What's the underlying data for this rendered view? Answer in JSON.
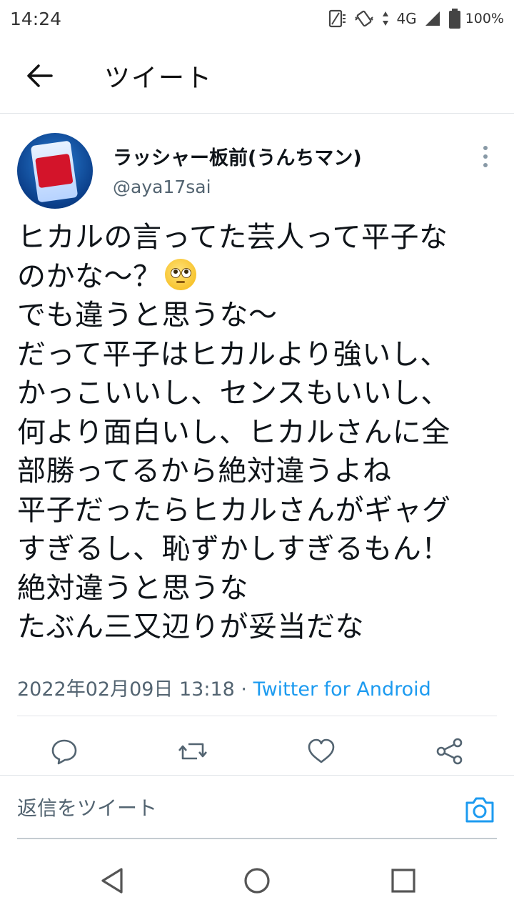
{
  "status_bar": {
    "time": "14:24",
    "network": "4G",
    "battery": "100%"
  },
  "header": {
    "title": "ツイート",
    "back_icon": "arrow-left-icon"
  },
  "tweet": {
    "display_name": "ラッシャー板前(うんちマン)",
    "handle": "@aya17sai",
    "text_lines": [
      "ヒカルの言ってた芸人って平子な",
      "のかな〜？",
      "でも違うと思うな〜",
      "だって平子はヒカルより強いし、",
      "かっこいいし、センスもいいし、",
      "何より面白いし、ヒカルさんに全",
      "部勝ってるから絶対違うよね",
      "平子だったらヒカルさんがギャグ",
      "すぎるし、恥ずかしすぎるもん！",
      "絶対違うと思うな",
      "たぶん三又辺りが妥当だな"
    ],
    "emoji": "pleading-face-emoji",
    "timestamp": "2022年02月09日 13:18",
    "separator": " · ",
    "source": "Twitter for Android"
  },
  "actions": [
    "reply-icon",
    "retweet-icon",
    "like-icon",
    "share-icon"
  ],
  "reply": {
    "placeholder": "返信をツイート"
  },
  "colors": {
    "accent": "#1d9bf0",
    "text": "#0f1419",
    "secondary": "#536471",
    "divider": "#e1e5e8"
  }
}
